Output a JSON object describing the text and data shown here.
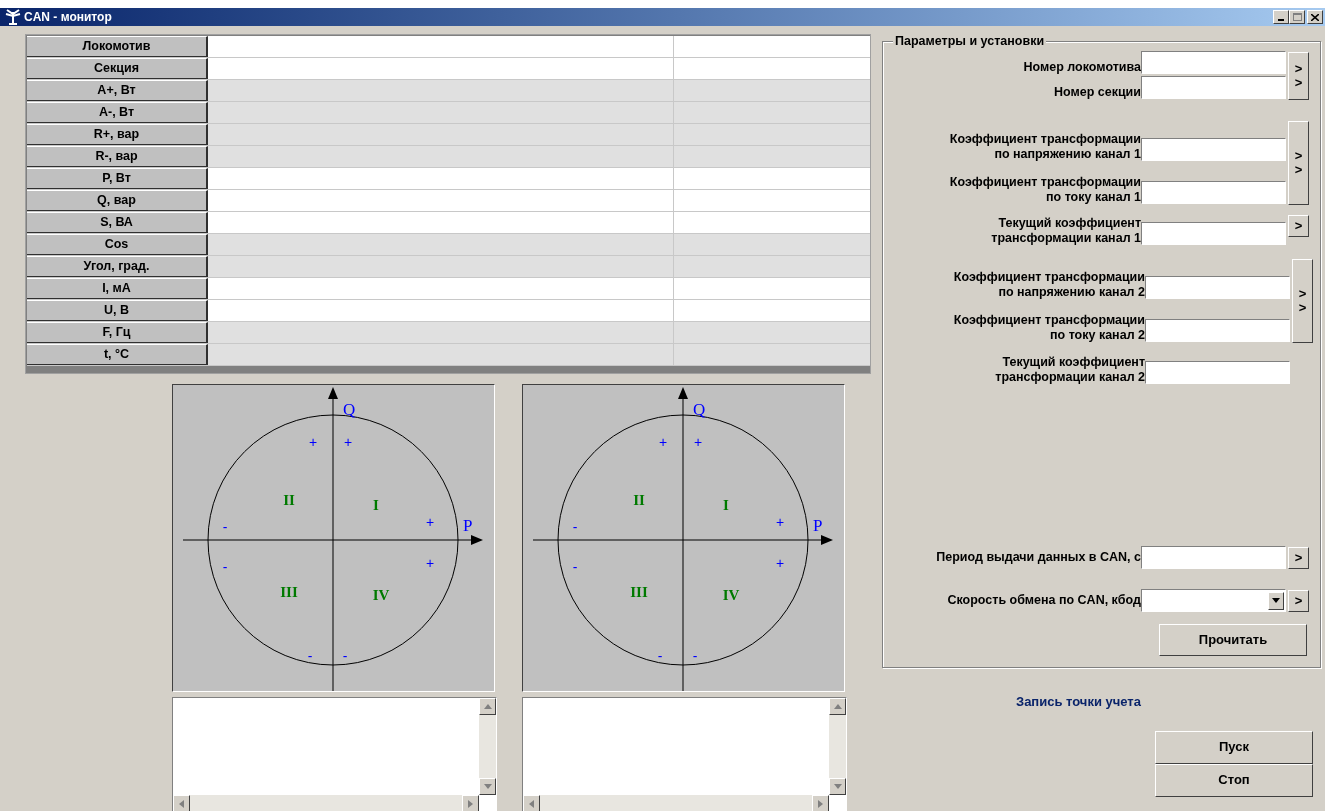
{
  "window": {
    "title": "CAN - монитор"
  },
  "table": {
    "rows": [
      {
        "label": "Локомотив",
        "shaded": false
      },
      {
        "label": "Секция",
        "shaded": false
      },
      {
        "label": "A+, Вт",
        "shaded": true
      },
      {
        "label": "A-, Вт",
        "shaded": true
      },
      {
        "label": "R+, вар",
        "shaded": true
      },
      {
        "label": "R-, вар",
        "shaded": true
      },
      {
        "label": "P, Вт",
        "shaded": false
      },
      {
        "label": "Q, вар",
        "shaded": false
      },
      {
        "label": "S, ВА",
        "shaded": false
      },
      {
        "label": "Cos",
        "shaded": true
      },
      {
        "label": "Угол, град.",
        "shaded": true
      },
      {
        "label": "I, мА",
        "shaded": false
      },
      {
        "label": "U, В",
        "shaded": false
      },
      {
        "label": "F, Гц",
        "shaded": true
      },
      {
        "label": "t, °C",
        "shaded": true
      }
    ]
  },
  "diagrams": [
    {
      "axis_y": "Q",
      "axis_x": "P",
      "quadrants": [
        "II",
        "I",
        "III",
        "IV"
      ],
      "signs": [
        "+",
        "+",
        "+",
        "+",
        "-",
        "-",
        "-",
        "-"
      ]
    },
    {
      "axis_y": "Q",
      "axis_x": "P",
      "quadrants": [
        "II",
        "I",
        "III",
        "IV"
      ],
      "signs": [
        "+",
        "+",
        "+",
        "+",
        "-",
        "-",
        "-",
        "-"
      ]
    }
  ],
  "settings": {
    "title": "Параметры и установки",
    "groups": [
      {
        "fields": [
          {
            "lines": [
              "Номер локомотива"
            ]
          },
          {
            "lines": [
              "Номер секции"
            ]
          }
        ],
        "button": [
          ">",
          ">"
        ]
      },
      {
        "fields": [
          {
            "lines": [
              "Коэффициент трансформации",
              "по напряжению канал 1"
            ]
          },
          {
            "lines": [
              "Коэффициент трансформации",
              "по току канал 1"
            ]
          }
        ],
        "button": [
          ">",
          ">"
        ]
      },
      {
        "fields": [
          {
            "lines": [
              "Текущий коэффициент",
              "трансформации канал 1"
            ]
          }
        ],
        "button": [
          ">"
        ]
      },
      {
        "fields": [
          {
            "lines": [
              "Коэффициент трансформации",
              "по напряжению канал 2"
            ]
          },
          {
            "lines": [
              "Коэффициент трансформации",
              "по току канал 2"
            ]
          }
        ],
        "button": [
          ">",
          ">"
        ]
      },
      {
        "fields": [
          {
            "lines": [
              "Текущий коэффициент",
              "трансформации канал 2"
            ]
          }
        ]
      }
    ],
    "period": {
      "label": "Период выдачи данных в CAN, с",
      "button": ">"
    },
    "speed": {
      "label": "Скорость обмена по CAN, кбод",
      "button": ">"
    },
    "read_button": "Прочитать"
  },
  "record_label": "Запись точки учета",
  "buttons": [
    "Пуск",
    "Стоп"
  ]
}
